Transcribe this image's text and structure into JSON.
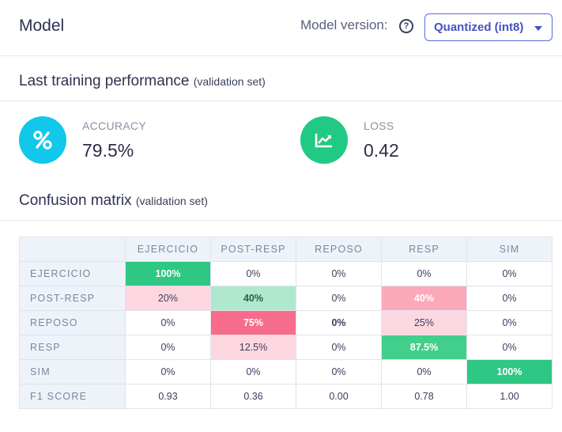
{
  "header": {
    "title": "Model",
    "model_version_label": "Model version:",
    "help_icon": "question-circle-icon",
    "selected_version": "Quantized (int8)"
  },
  "training": {
    "title": "Last training performance",
    "subtitle": "(validation set)"
  },
  "metrics": {
    "accuracy": {
      "label": "ACCURACY",
      "value": "79.5%",
      "icon": "percent-icon",
      "color": "#11c8ea"
    },
    "loss": {
      "label": "LOSS",
      "value": "0.42",
      "icon": "trend-chart-icon",
      "color": "#22c985"
    }
  },
  "confusion": {
    "title": "Confusion matrix",
    "subtitle": "(validation set)",
    "columns": [
      "EJERCICIO",
      "POST-RESP",
      "REPOSO",
      "RESP",
      "SIM"
    ],
    "rows": [
      {
        "label": "EJERCICIO",
        "cells": [
          "100%",
          "0%",
          "0%",
          "0%",
          "0%"
        ]
      },
      {
        "label": "POST-RESP",
        "cells": [
          "20%",
          "40%",
          "0%",
          "40%",
          "0%"
        ]
      },
      {
        "label": "REPOSO",
        "cells": [
          "0%",
          "75%",
          "0%",
          "25%",
          "0%"
        ]
      },
      {
        "label": "RESP",
        "cells": [
          "0%",
          "12.5%",
          "0%",
          "87.5%",
          "0%"
        ]
      },
      {
        "label": "SIM",
        "cells": [
          "0%",
          "0%",
          "0%",
          "0%",
          "100%"
        ]
      }
    ],
    "f1": {
      "label": "F1 SCORE",
      "cells": [
        "0.93",
        "0.36",
        "0.00",
        "0.78",
        "1.00"
      ]
    }
  }
}
